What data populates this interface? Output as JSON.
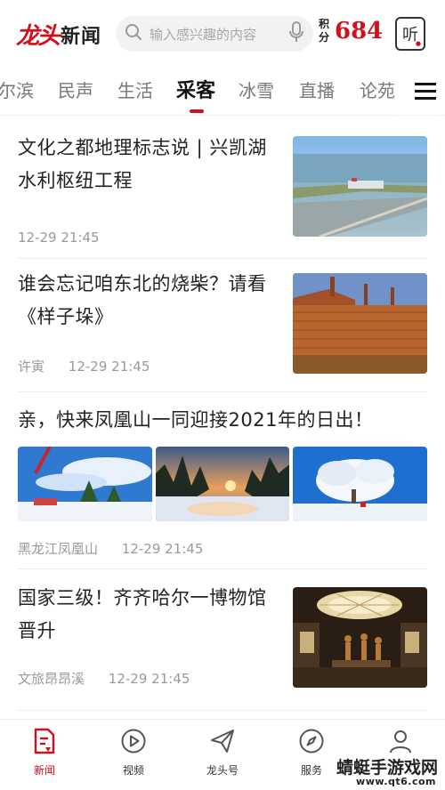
{
  "header": {
    "logo_mark": "龙头",
    "logo_text": "新闻",
    "search_placeholder": "输入感兴趣的内容",
    "points_label_1": "积",
    "points_label_2": "分",
    "points_value": "684",
    "listen_label": "听"
  },
  "tabs": [
    {
      "label": "尔滨"
    },
    {
      "label": "民声"
    },
    {
      "label": "生活"
    },
    {
      "label": "采客"
    },
    {
      "label": "冰雪"
    },
    {
      "label": "直播"
    },
    {
      "label": "论苑"
    }
  ],
  "feed": {
    "items": [
      {
        "title": "文化之都地理标志说 | 兴凯湖水利枢纽工程",
        "source": "",
        "time": "12-29 21:45"
      },
      {
        "title": "谁会忘记咱东北的烧柴？请看《样子垛》",
        "source": "许寅",
        "time": "12-29 21:45"
      },
      {
        "title": "亲，快来凤凰山一同迎接2021年的日出！",
        "source": "黑龙江凤凰山",
        "time": "12-29 21:45"
      },
      {
        "title": "国家三级！齐齐哈尔一博物馆晋升",
        "source": "文旅昂昂溪",
        "time": "12-29 21:45"
      }
    ]
  },
  "bottom_nav": [
    {
      "label": "新闻",
      "icon": "news-icon",
      "active": true
    },
    {
      "label": "视频",
      "icon": "play-icon",
      "active": false
    },
    {
      "label": "龙头号",
      "icon": "paper-plane-icon",
      "active": false
    },
    {
      "label": "服务",
      "icon": "compass-icon",
      "active": false
    },
    {
      "label": "",
      "icon": "user-icon",
      "active": false
    }
  ],
  "watermark": {
    "title": "蜻蜓手游戏网",
    "url": "www.qt6.com"
  },
  "colors": {
    "accent": "#d0111b",
    "text": "#222222",
    "muted": "#9a9a9a"
  }
}
